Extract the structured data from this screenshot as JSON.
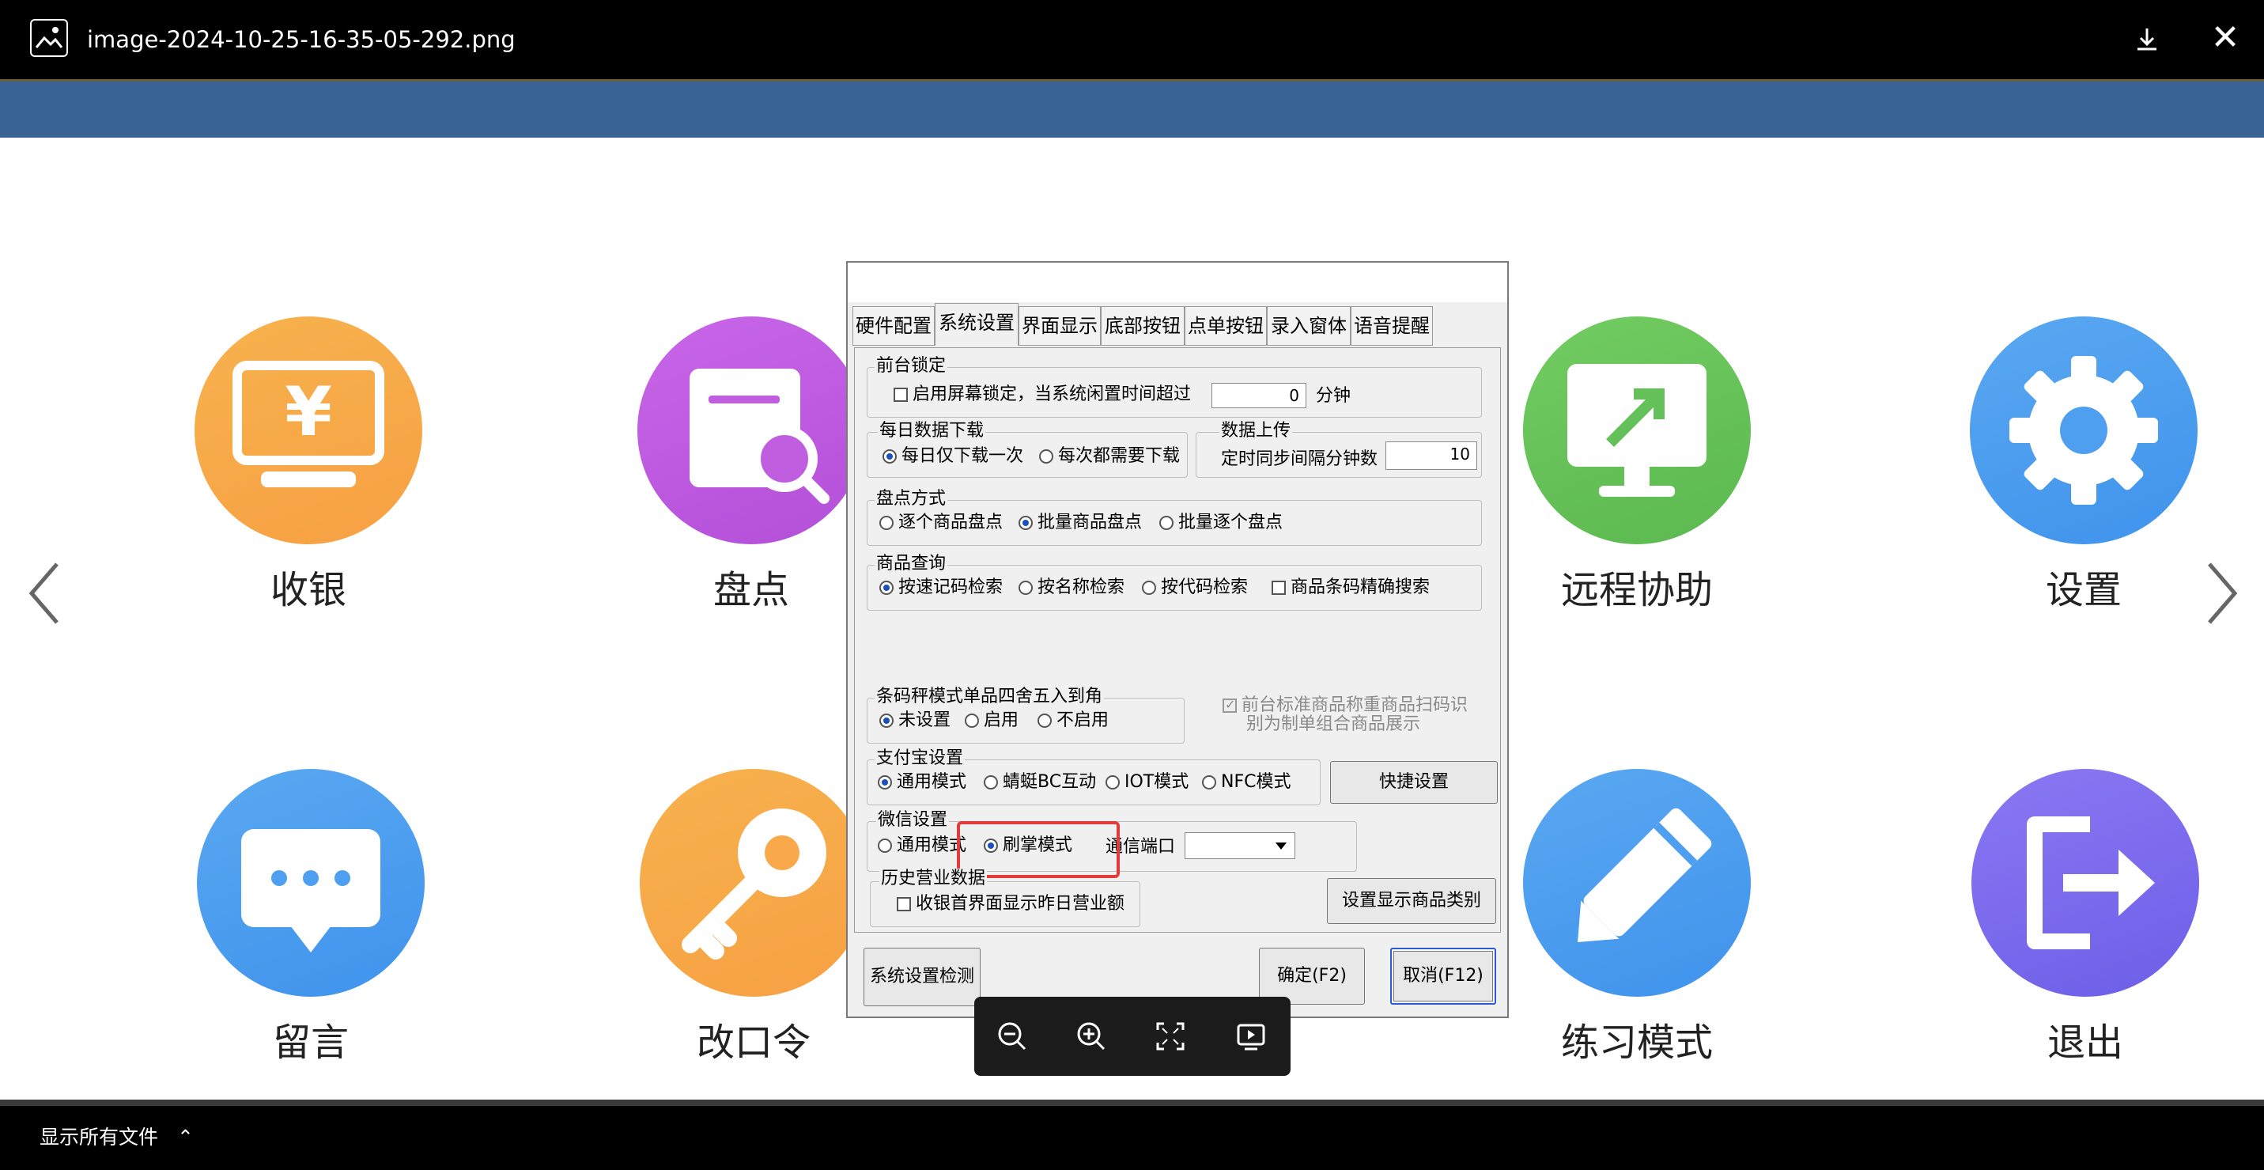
{
  "viewer": {
    "file_name": "image-2024-10-25-16-35-05-292.png",
    "show_all_files": "显示所有文件"
  },
  "app_tiles": [
    {
      "label": "收银",
      "icon": "cashier-icon"
    },
    {
      "label": "盘点",
      "icon": "inventory-search-icon"
    },
    {
      "label": "远程协助",
      "icon": "remote-assist-icon"
    },
    {
      "label": "设置",
      "icon": "gear-icon"
    },
    {
      "label": "留言",
      "icon": "message-icon"
    },
    {
      "label": "改口令",
      "icon": "key-icon"
    },
    {
      "label": "练习模式",
      "icon": "pencil-icon"
    },
    {
      "label": "退出",
      "icon": "exit-icon"
    }
  ],
  "dialog": {
    "tabs": [
      "硬件配置",
      "系统设置",
      "界面显示",
      "底部按钮",
      "点单按钮",
      "录入窗体",
      "语音提醒"
    ],
    "active_tab": "系统设置",
    "lock": {
      "title": "前台锁定",
      "checkbox_label": "启用屏幕锁定，当系统闲置时间超过",
      "value": "0",
      "unit": "分钟"
    },
    "daily_download": {
      "title": "每日数据下载",
      "options": [
        "每日仅下载一次",
        "每次都需要下载"
      ],
      "selected": "每日仅下载一次"
    },
    "data_upload": {
      "title": "数据上传",
      "label": "定时同步间隔分钟数",
      "value": "10"
    },
    "inventory_mode": {
      "title": "盘点方式",
      "options": [
        "逐个商品盘点",
        "批量商品盘点",
        "批量逐个盘点"
      ],
      "selected": "批量商品盘点"
    },
    "product_query": {
      "title": "商品查询",
      "options": [
        "按速记码检索",
        "按名称检索",
        "按代码检索"
      ],
      "selected": "按速记码检索",
      "checkbox_label": "商品条码精确搜索"
    },
    "barcode_scale": {
      "title": "条码秤模式单品四舍五入到角",
      "options": [
        "未设置",
        "启用",
        "不启用"
      ],
      "selected": "未设置",
      "disabled_checkbox_line1": "前台标准商品称重商品扫码识",
      "disabled_checkbox_line2": "别为制单组合商品展示"
    },
    "alipay": {
      "title": "支付宝设置",
      "options": [
        "通用模式",
        "蜻蜓BC互动",
        "IOT模式",
        "NFC模式"
      ],
      "selected": "通用模式",
      "quick_button": "快捷设置"
    },
    "wechat": {
      "title": "微信设置",
      "options": [
        "通用模式",
        "刷掌模式"
      ],
      "selected": "刷掌模式",
      "port_label": "通信端口",
      "port_value": ""
    },
    "history": {
      "title": "历史营业数据",
      "checkbox_label": "收银首界面显示昨日营业额",
      "category_button": "设置显示商品类别"
    },
    "buttons": {
      "check": "系统设置检测",
      "ok": "确定(F2)",
      "cancel": "取消(F12)"
    }
  },
  "colors": {
    "blue_bar": "#3a6395",
    "highlight": "#e23b3b",
    "cashier": "#f9a94a",
    "inventory": "#c05ee0",
    "remote": "#64c15a",
    "settings": "#4e9ff0",
    "message": "#4e9ff0",
    "key": "#f9a94a",
    "practice": "#4e9ff0",
    "exit": "#7b6cf0"
  }
}
